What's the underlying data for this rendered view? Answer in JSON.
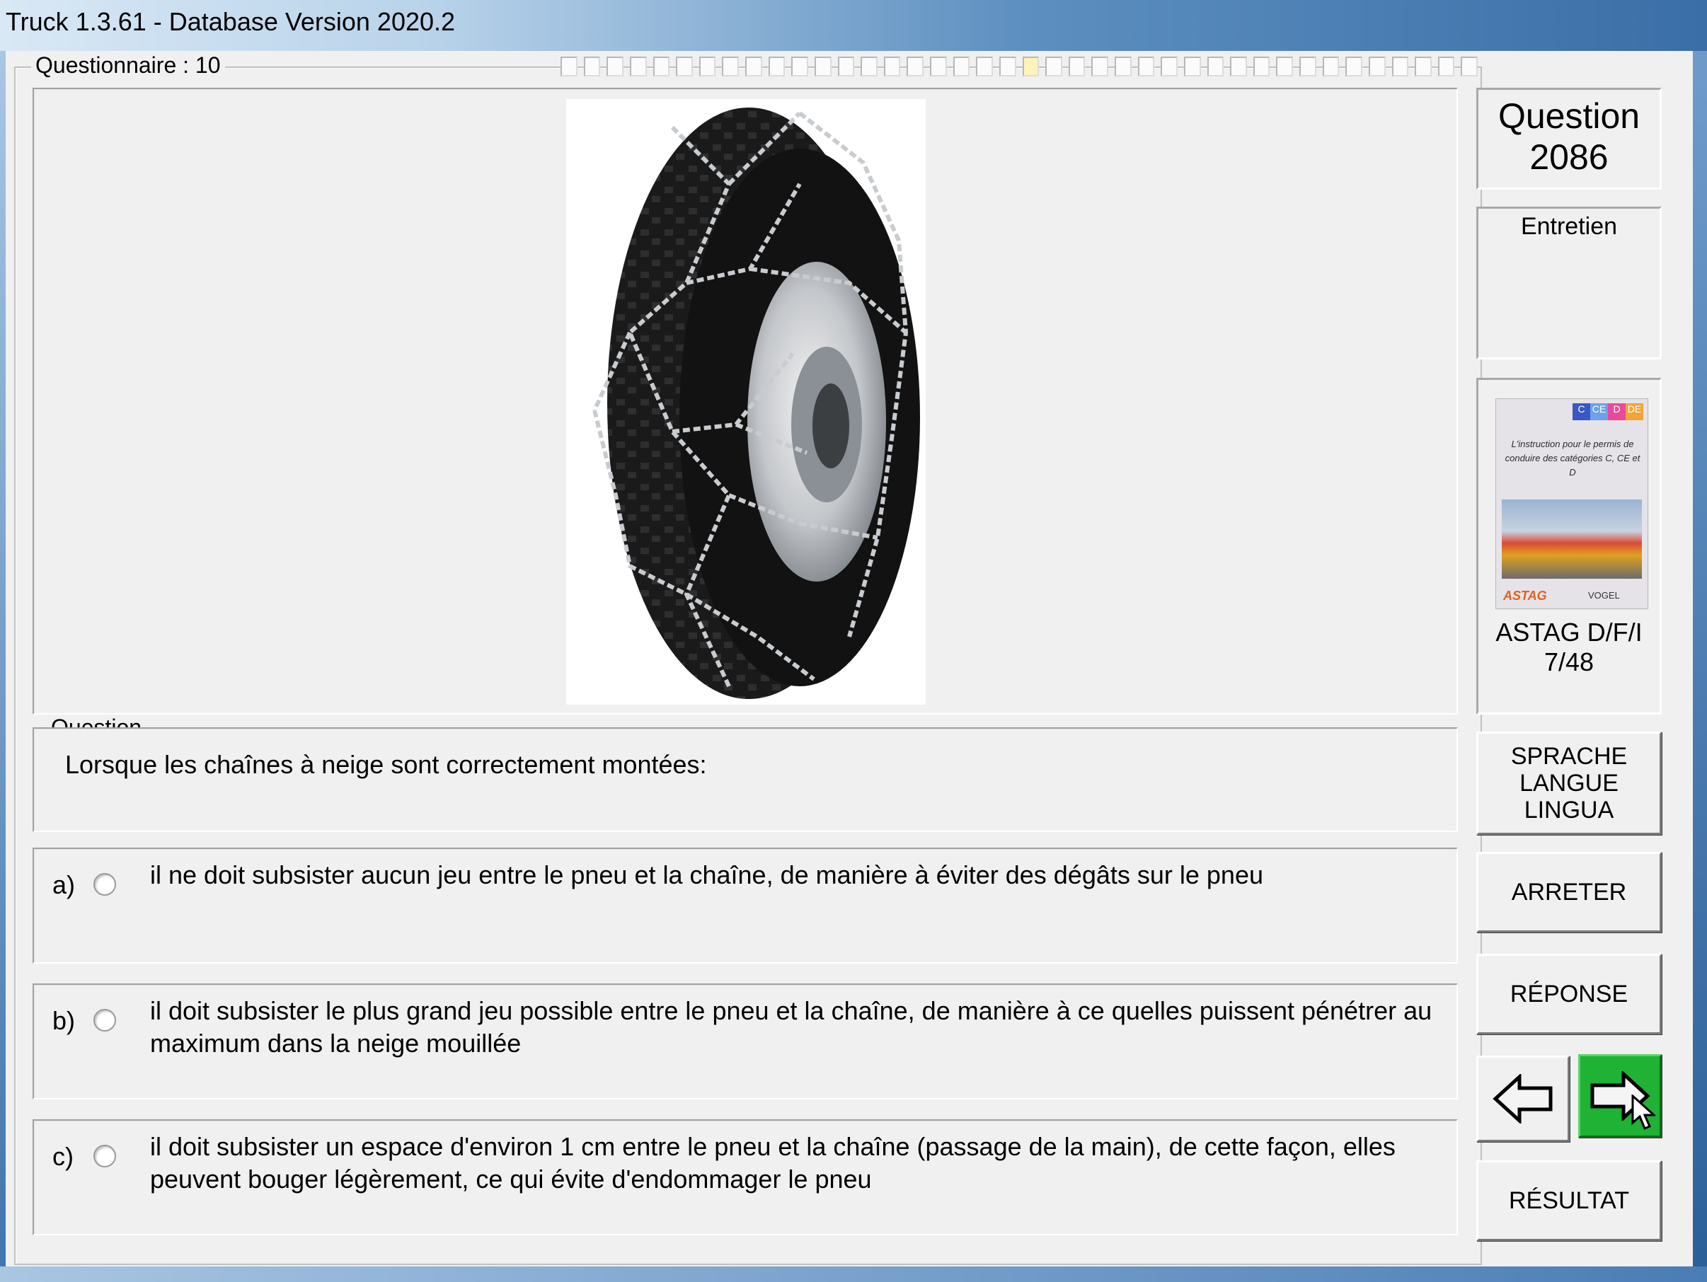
{
  "window": {
    "title": "Truck 1.3.61 - Database Version 2020.2"
  },
  "quiz": {
    "questionnaire_label": "Questionnaire : 10",
    "progress": {
      "total_segments": 40,
      "current_segment": 21
    }
  },
  "question": {
    "group_label": "Question",
    "text": "Lorsque les chaînes à neige sont correctement montées:",
    "image": "tire-with-snow-chains"
  },
  "answers": [
    {
      "label": "a)",
      "text": "il ne doit subsister aucun jeu entre le pneu et la chaîne, de manière à éviter des dégâts sur le pneu"
    },
    {
      "label": "b)",
      "text": "il doit subsister le plus grand jeu possible entre le pneu et la chaîne, de manière à ce quelles puissent pénétrer au maximum dans la neige mouillée"
    },
    {
      "label": "c)",
      "text": "il doit subsister un espace d'environ 1 cm entre le pneu et la chaîne (passage de la main), de cette façon, elles peuvent bouger légèrement, ce qui évite d'endommager le pneu"
    }
  ],
  "sidebar": {
    "question_word": "Question",
    "question_number": "2086",
    "category": "Entretien",
    "book": {
      "cover_tags": [
        "C",
        "CE",
        "D",
        "DE"
      ],
      "cover_text": "L'instruction pour le permis de conduire des catégories C, CE et D",
      "logo_left": "ASTAG",
      "logo_right": "VOGEL",
      "title": "ASTAG D/F/I",
      "pages": "7/48"
    },
    "buttons": {
      "language": [
        "SPRACHE",
        "LANGUE",
        "LINGUA"
      ],
      "stop": "ARRETER",
      "answer": "RÉPONSE",
      "result": "RÉSULTAT",
      "prev_icon": "arrow-left-icon",
      "next_icon": "arrow-right-icon"
    }
  },
  "colors": {
    "next_button": "#1fb234",
    "title_bar_end": "#3a6ea6"
  }
}
